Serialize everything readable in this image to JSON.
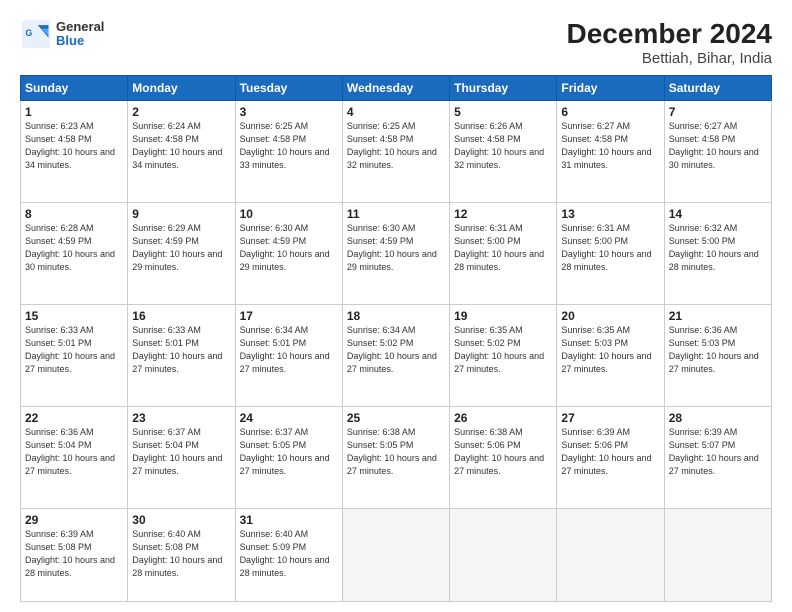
{
  "logo": {
    "general": "General",
    "blue": "Blue"
  },
  "title": "December 2024",
  "subtitle": "Bettiah, Bihar, India",
  "days_header": [
    "Sunday",
    "Monday",
    "Tuesday",
    "Wednesday",
    "Thursday",
    "Friday",
    "Saturday"
  ],
  "weeks": [
    [
      {
        "num": "1",
        "sunrise": "6:23 AM",
        "sunset": "4:58 PM",
        "daylight": "10 hours and 34 minutes."
      },
      {
        "num": "2",
        "sunrise": "6:24 AM",
        "sunset": "4:58 PM",
        "daylight": "10 hours and 34 minutes."
      },
      {
        "num": "3",
        "sunrise": "6:25 AM",
        "sunset": "4:58 PM",
        "daylight": "10 hours and 33 minutes."
      },
      {
        "num": "4",
        "sunrise": "6:25 AM",
        "sunset": "4:58 PM",
        "daylight": "10 hours and 32 minutes."
      },
      {
        "num": "5",
        "sunrise": "6:26 AM",
        "sunset": "4:58 PM",
        "daylight": "10 hours and 32 minutes."
      },
      {
        "num": "6",
        "sunrise": "6:27 AM",
        "sunset": "4:58 PM",
        "daylight": "10 hours and 31 minutes."
      },
      {
        "num": "7",
        "sunrise": "6:27 AM",
        "sunset": "4:58 PM",
        "daylight": "10 hours and 30 minutes."
      }
    ],
    [
      {
        "num": "8",
        "sunrise": "6:28 AM",
        "sunset": "4:59 PM",
        "daylight": "10 hours and 30 minutes."
      },
      {
        "num": "9",
        "sunrise": "6:29 AM",
        "sunset": "4:59 PM",
        "daylight": "10 hours and 29 minutes."
      },
      {
        "num": "10",
        "sunrise": "6:30 AM",
        "sunset": "4:59 PM",
        "daylight": "10 hours and 29 minutes."
      },
      {
        "num": "11",
        "sunrise": "6:30 AM",
        "sunset": "4:59 PM",
        "daylight": "10 hours and 29 minutes."
      },
      {
        "num": "12",
        "sunrise": "6:31 AM",
        "sunset": "5:00 PM",
        "daylight": "10 hours and 28 minutes."
      },
      {
        "num": "13",
        "sunrise": "6:31 AM",
        "sunset": "5:00 PM",
        "daylight": "10 hours and 28 minutes."
      },
      {
        "num": "14",
        "sunrise": "6:32 AM",
        "sunset": "5:00 PM",
        "daylight": "10 hours and 28 minutes."
      }
    ],
    [
      {
        "num": "15",
        "sunrise": "6:33 AM",
        "sunset": "5:01 PM",
        "daylight": "10 hours and 27 minutes."
      },
      {
        "num": "16",
        "sunrise": "6:33 AM",
        "sunset": "5:01 PM",
        "daylight": "10 hours and 27 minutes."
      },
      {
        "num": "17",
        "sunrise": "6:34 AM",
        "sunset": "5:01 PM",
        "daylight": "10 hours and 27 minutes."
      },
      {
        "num": "18",
        "sunrise": "6:34 AM",
        "sunset": "5:02 PM",
        "daylight": "10 hours and 27 minutes."
      },
      {
        "num": "19",
        "sunrise": "6:35 AM",
        "sunset": "5:02 PM",
        "daylight": "10 hours and 27 minutes."
      },
      {
        "num": "20",
        "sunrise": "6:35 AM",
        "sunset": "5:03 PM",
        "daylight": "10 hours and 27 minutes."
      },
      {
        "num": "21",
        "sunrise": "6:36 AM",
        "sunset": "5:03 PM",
        "daylight": "10 hours and 27 minutes."
      }
    ],
    [
      {
        "num": "22",
        "sunrise": "6:36 AM",
        "sunset": "5:04 PM",
        "daylight": "10 hours and 27 minutes."
      },
      {
        "num": "23",
        "sunrise": "6:37 AM",
        "sunset": "5:04 PM",
        "daylight": "10 hours and 27 minutes."
      },
      {
        "num": "24",
        "sunrise": "6:37 AM",
        "sunset": "5:05 PM",
        "daylight": "10 hours and 27 minutes."
      },
      {
        "num": "25",
        "sunrise": "6:38 AM",
        "sunset": "5:05 PM",
        "daylight": "10 hours and 27 minutes."
      },
      {
        "num": "26",
        "sunrise": "6:38 AM",
        "sunset": "5:06 PM",
        "daylight": "10 hours and 27 minutes."
      },
      {
        "num": "27",
        "sunrise": "6:39 AM",
        "sunset": "5:06 PM",
        "daylight": "10 hours and 27 minutes."
      },
      {
        "num": "28",
        "sunrise": "6:39 AM",
        "sunset": "5:07 PM",
        "daylight": "10 hours and 27 minutes."
      }
    ],
    [
      {
        "num": "29",
        "sunrise": "6:39 AM",
        "sunset": "5:08 PM",
        "daylight": "10 hours and 28 minutes."
      },
      {
        "num": "30",
        "sunrise": "6:40 AM",
        "sunset": "5:08 PM",
        "daylight": "10 hours and 28 minutes."
      },
      {
        "num": "31",
        "sunrise": "6:40 AM",
        "sunset": "5:09 PM",
        "daylight": "10 hours and 28 minutes."
      },
      null,
      null,
      null,
      null
    ]
  ]
}
